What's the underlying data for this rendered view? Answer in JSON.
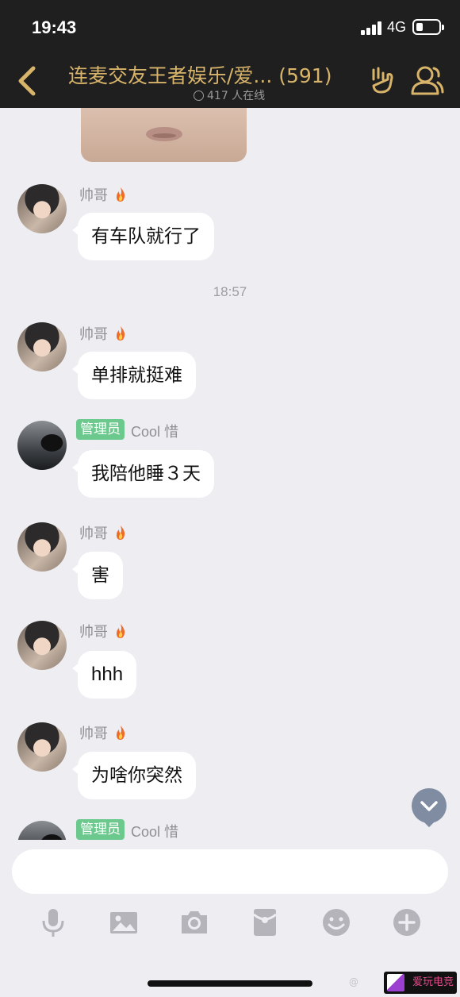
{
  "status_bar": {
    "time": "19:43",
    "network": "4G",
    "battery_fraction": 0.3
  },
  "header": {
    "title": "连麦交友王者娱乐/爱...",
    "member_count": "(591)",
    "online": "417 人在线"
  },
  "messages": [
    {
      "sender": "帅哥",
      "badge": "",
      "text": "有车队就行了"
    },
    {
      "timestamp": "18:57"
    },
    {
      "sender": "帅哥",
      "badge": "",
      "text": "单排就挺难"
    },
    {
      "sender": "Cool 惜",
      "badge": "管理员",
      "text": "我陪他睡３天"
    },
    {
      "sender": "帅哥",
      "badge": "",
      "text": "害"
    },
    {
      "sender": "帅哥",
      "badge": "",
      "text": "hhh"
    },
    {
      "sender": "帅哥",
      "badge": "",
      "text": "为啥你突然"
    },
    {
      "sender": "Cool 惜",
      "badge": "管理员",
      "text": ""
    }
  ],
  "input": {
    "value": "",
    "placeholder": ""
  },
  "toolbar": [
    "mic-icon",
    "image-icon",
    "camera-icon",
    "red-packet-icon",
    "emoji-icon",
    "plus-icon"
  ],
  "watermark": {
    "text": "爱玩电竞",
    "prefix": "@"
  },
  "colors": {
    "header_bg": "#1f1f1f",
    "title_gold": "#d8b46a",
    "admin_badge": "#6cc98d",
    "chat_bg": "#ededf2"
  }
}
